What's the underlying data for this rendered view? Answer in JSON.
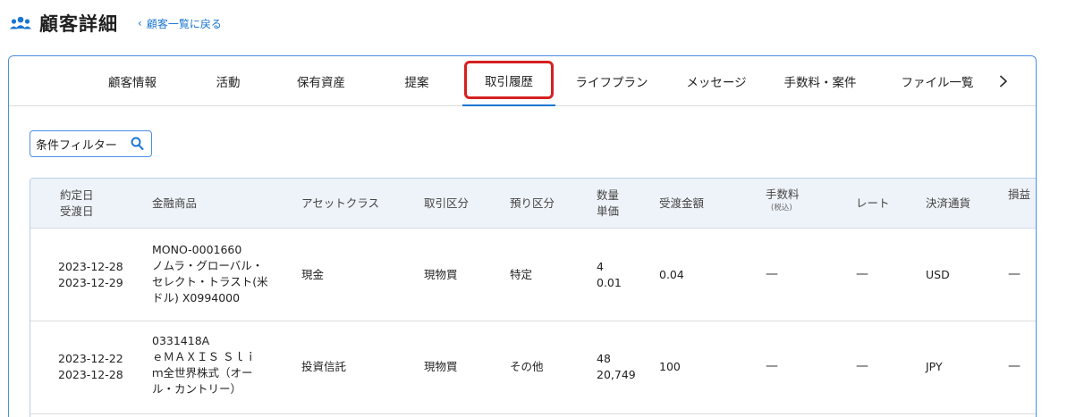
{
  "header": {
    "title": "顧客詳細",
    "back_label": "顧客一覧に戻る"
  },
  "tabs": [
    {
      "label": "顧客情報"
    },
    {
      "label": "活動"
    },
    {
      "label": "保有資産"
    },
    {
      "label": "提案"
    },
    {
      "label": "取引履歴",
      "active": true
    },
    {
      "label": "ライフプラン"
    },
    {
      "label": "メッセージ"
    },
    {
      "label": "手数料・案件"
    },
    {
      "label": "ファイル一覧"
    }
  ],
  "filter": {
    "label": "条件フィルター"
  },
  "table": {
    "headers": {
      "date_line1": "約定日",
      "date_line2": "受渡日",
      "product": "金融商品",
      "asset_class": "アセットクラス",
      "trade_type": "取引区分",
      "deposit_type": "預り区分",
      "qty_line1": "数量",
      "qty_line2": "単価",
      "amount": "受渡金額",
      "fee_line1": "手数料",
      "fee_line2": "(税込)",
      "rate": "レート",
      "currency": "決済通貨",
      "pl": "損益"
    },
    "rows": [
      {
        "trade_date": "2023-12-28",
        "settle_date": "2023-12-29",
        "product": [
          "MONO-0001660",
          "ノムラ・グローバル・",
          "セレクト・トラスト(米",
          "ドル) X0994000"
        ],
        "asset_class": "現金",
        "trade_type": "現物買",
        "deposit_type": "特定",
        "qty": "4",
        "price": "0.01",
        "amount": "0.04",
        "fee": "—",
        "rate": "—",
        "currency": "USD",
        "pl": "—"
      },
      {
        "trade_date": "2023-12-22",
        "settle_date": "2023-12-28",
        "product": [
          "0331418A",
          "ｅＭＡＸＩＳ Ｓｌｉ",
          "ｍ全世界株式（オー",
          "ル・カントリー）"
        ],
        "asset_class": "投資信託",
        "trade_type": "現物買",
        "deposit_type": "その他",
        "qty": "48",
        "price": "20,749",
        "amount": "100",
        "fee": "—",
        "rate": "—",
        "currency": "JPY",
        "pl": "—"
      }
    ]
  },
  "colors": {
    "accent": "#1976d2",
    "highlight": "#d62020",
    "header_bg": "#eef3f9"
  }
}
